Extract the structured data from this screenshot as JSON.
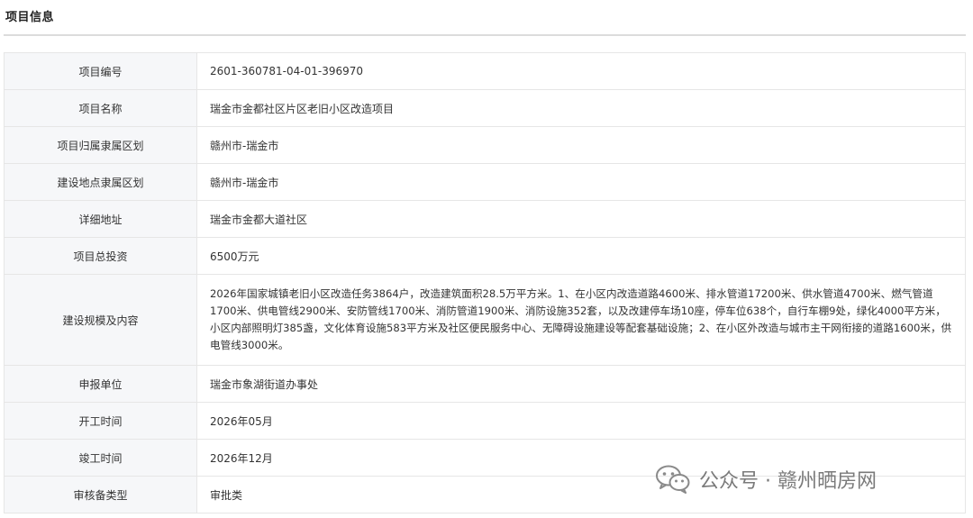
{
  "section": {
    "title": "项目信息"
  },
  "rows": [
    {
      "label": "项目编号",
      "value": "2601-360781-04-01-396970"
    },
    {
      "label": "项目名称",
      "value": "瑞金市金都社区片区老旧小区改造项目"
    },
    {
      "label": "项目归属隶属区划",
      "value": "赣州市-瑞金市"
    },
    {
      "label": "建设地点隶属区划",
      "value": "赣州市-瑞金市"
    },
    {
      "label": "详细地址",
      "value": "瑞金市金都大道社区"
    },
    {
      "label": "项目总投资",
      "value": "6500万元"
    },
    {
      "label": "建设规模及内容",
      "value": "2026年国家城镇老旧小区改造任务3864户，改造建筑面积28.5万平方米。1、在小区内改造道路4600米、排水管道17200米、供水管道4700米、燃气管道1700米、供电管线2900米、安防管线1700米、消防管道1900米、消防设施352套，以及改建停车场10座，停车位638个，自行车棚9处，绿化4000平方米，小区内部照明灯385盏，文化体育设施583平方米及社区便民服务中心、无障碍设施建设等配套基础设施；2、在小区外改造与城市主干网衔接的道路1600米，供电管线3000米。"
    },
    {
      "label": "申报单位",
      "value": "瑞金市象湖街道办事处"
    },
    {
      "label": "开工时间",
      "value": "2026年05月"
    },
    {
      "label": "竣工时间",
      "value": "2026年12月"
    },
    {
      "label": "审核备类型",
      "value": "审批类"
    }
  ],
  "watermark": {
    "icon": "wechat-icon",
    "text": "公众号 · 赣州晒房网"
  },
  "colors": {
    "label_bg": "#f6f7f9",
    "border": "#e6e6e6",
    "text": "#333333"
  }
}
